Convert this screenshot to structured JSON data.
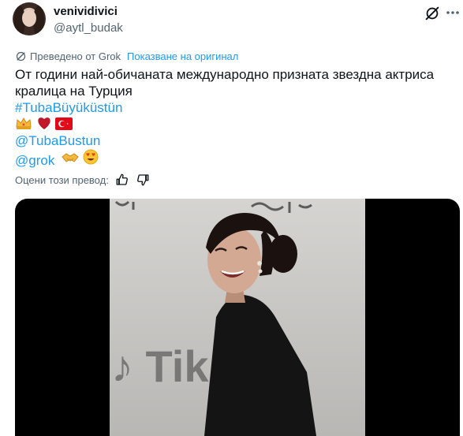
{
  "author": {
    "display_name": "venividivici",
    "handle": "@aytl_budak"
  },
  "translation": {
    "label": "Преведено от Grok",
    "show_original": "Показване на оригинал"
  },
  "tweet": {
    "lines": [
      "От години най-обичаната международно призната звездна актриса",
      "кралица на Турция"
    ],
    "hashtag": "#TubaBüyüküstün",
    "mention1": "@TubaBustun",
    "mention2": "@grok"
  },
  "rate": {
    "label": "Оцени този превод:"
  },
  "icons": {
    "grok": "grok-icon",
    "more": "more-icon",
    "translate": "translate-icon",
    "thumbs_up": "thumbs-up-icon",
    "thumbs_down": "thumbs-down-icon"
  },
  "colors": {
    "link": "#1d9bf0",
    "text": "#0f1419",
    "muted": "#536471"
  }
}
